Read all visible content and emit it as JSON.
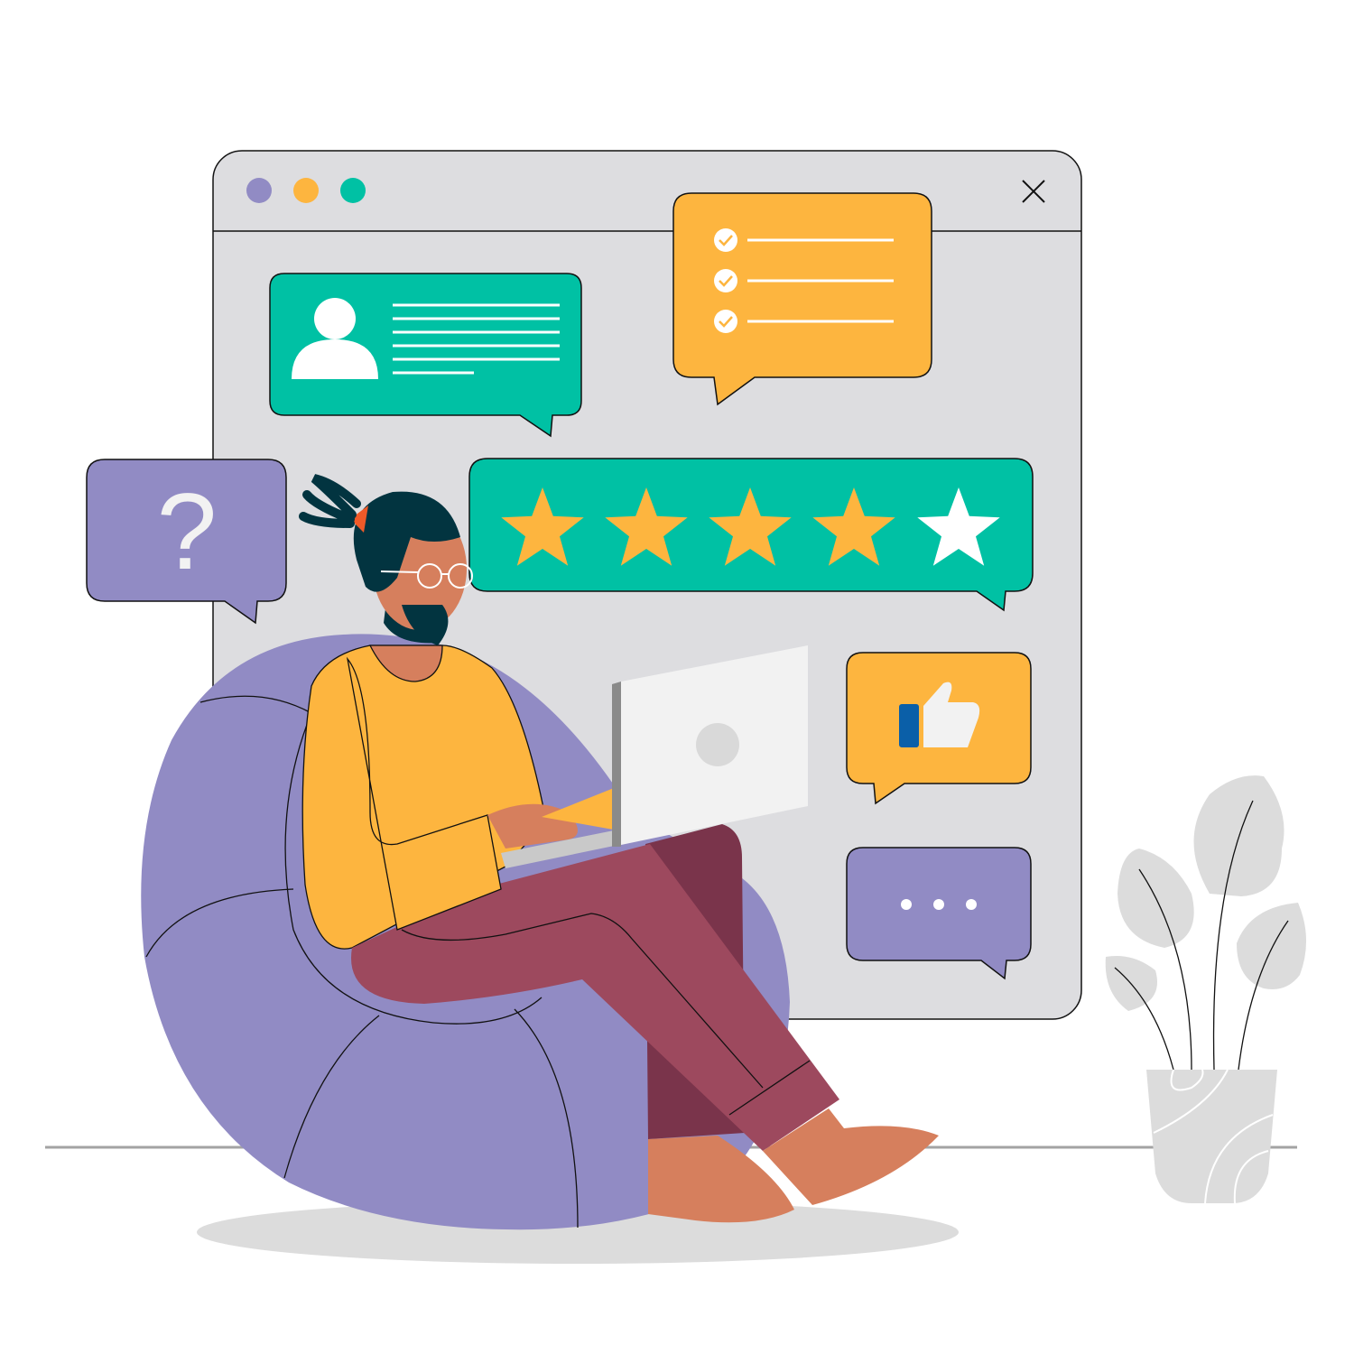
{
  "window": {
    "dots": [
      {
        "name": "window-dot-purple",
        "color": "#918bc4"
      },
      {
        "name": "window-dot-orange",
        "color": "#fdb53f"
      },
      {
        "name": "window-dot-teal",
        "color": "#00c1a4"
      }
    ],
    "close_icon": "close-icon",
    "background": "#dddde0"
  },
  "question_bubble": {
    "text": "?",
    "color": "#918bc4"
  },
  "rating": {
    "value": 4,
    "max": 5,
    "star_color": "#fdb53f",
    "empty_star_color": "#ffffff",
    "card_color": "#00c1a4"
  },
  "checklist": {
    "items_checked": 3,
    "color": "#fdb53f"
  },
  "profile_card": {
    "icon": "user-icon",
    "color": "#00c1a4"
  },
  "like_card": {
    "icon": "thumbs-up-icon",
    "color": "#fdb53f"
  },
  "typing_card": {
    "icon": "ellipsis-icon",
    "color": "#918bc4"
  },
  "colors": {
    "shirt": "#fdb53f",
    "pants": "#9d495e",
    "skin": "#d67f5d",
    "hair": "#023440",
    "beanbag": "#918bc4"
  }
}
